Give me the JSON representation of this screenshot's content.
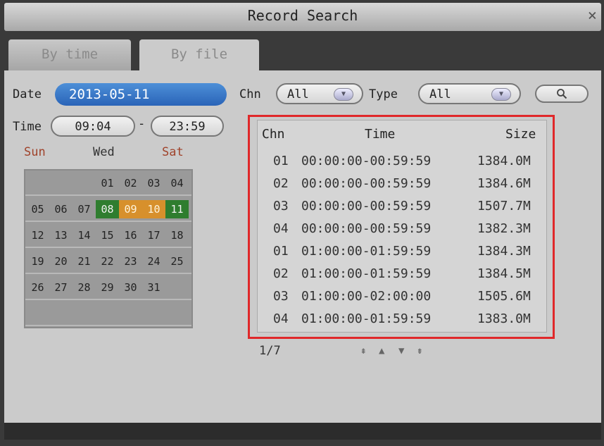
{
  "window": {
    "title": "Record Search",
    "close": "×"
  },
  "tabs": [
    {
      "label": "By time"
    },
    {
      "label": "By file"
    }
  ],
  "form": {
    "date_label": "Date",
    "date_value": "2013-05-11",
    "time_label": "Time",
    "time_from": "09:04",
    "time_sep": "-",
    "time_to": "23:59",
    "chn_label": "Chn",
    "chn_value": "All",
    "type_label": "Type",
    "type_value": "All",
    "search_icon": "search-icon"
  },
  "calendar": {
    "headers": {
      "sun": "Sun",
      "wed": "Wed",
      "sat": "Sat"
    },
    "weeks": [
      [
        "",
        "",
        "",
        "01",
        "02",
        "03",
        "04"
      ],
      [
        "05",
        "06",
        "07",
        "08",
        "09",
        "10",
        "11"
      ],
      [
        "12",
        "13",
        "14",
        "15",
        "16",
        "17",
        "18"
      ],
      [
        "19",
        "20",
        "21",
        "22",
        "23",
        "24",
        "25"
      ],
      [
        "26",
        "27",
        "28",
        "29",
        "30",
        "31",
        ""
      ],
      [
        "",
        "",
        "",
        "",
        "",
        "",
        ""
      ]
    ],
    "green_days": [
      "08",
      "11"
    ],
    "orange_days": [
      "09",
      "10"
    ]
  },
  "results": {
    "headers": {
      "chn": "Chn",
      "time": "Time",
      "size": "Size"
    },
    "rows": [
      {
        "chn": "01",
        "time": "00:00:00-00:59:59",
        "size": "1384.0M"
      },
      {
        "chn": "02",
        "time": "00:00:00-00:59:59",
        "size": "1384.6M"
      },
      {
        "chn": "03",
        "time": "00:00:00-00:59:59",
        "size": "1507.7M"
      },
      {
        "chn": "04",
        "time": "00:00:00-00:59:59",
        "size": "1382.3M"
      },
      {
        "chn": "01",
        "time": "01:00:00-01:59:59",
        "size": "1384.3M"
      },
      {
        "chn": "02",
        "time": "01:00:00-01:59:59",
        "size": "1384.5M"
      },
      {
        "chn": "03",
        "time": "01:00:00-02:00:00",
        "size": "1505.6M"
      },
      {
        "chn": "04",
        "time": "01:00:00-01:59:59",
        "size": "1383.0M"
      }
    ],
    "page": "1/7"
  },
  "pager_icons": [
    "first-page-icon",
    "prev-page-icon",
    "next-page-icon",
    "last-page-icon"
  ],
  "colors": {
    "date_field": "#2a64b8",
    "green_day": "#2f7d2f",
    "orange_day": "#d7902c",
    "highlight_box": "#e0282a"
  }
}
